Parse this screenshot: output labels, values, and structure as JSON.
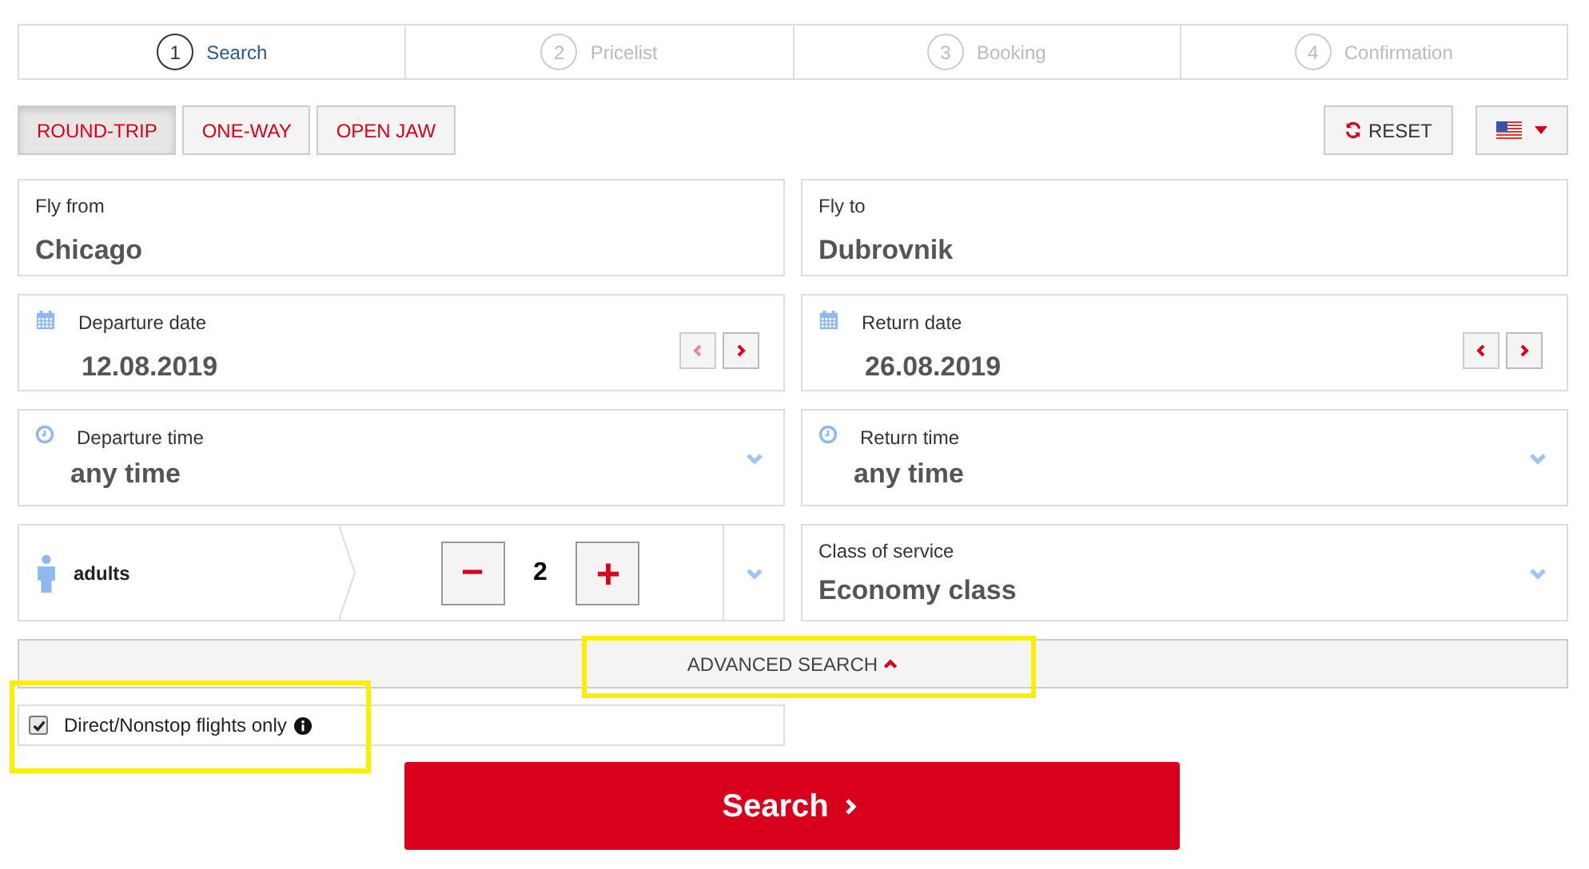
{
  "steps": [
    {
      "number": "1",
      "label": "Search",
      "selected": true
    },
    {
      "number": "2",
      "label": "Pricelist",
      "selected": false
    },
    {
      "number": "3",
      "label": "Booking",
      "selected": false
    },
    {
      "number": "4",
      "label": "Confirmation",
      "selected": false
    }
  ],
  "trip_types": [
    {
      "label": "ROUND-TRIP",
      "selected": true
    },
    {
      "label": "ONE-WAY",
      "selected": false
    },
    {
      "label": "OPEN JAW",
      "selected": false
    }
  ],
  "reset_button": "RESET",
  "fly_from": {
    "label": "Fly from",
    "value": "Chicago"
  },
  "fly_to": {
    "label": "Fly to",
    "value": "Dubrovnik"
  },
  "dates": [
    {
      "label": "Departure date",
      "value": "12.08.2019",
      "prev_disabled": true
    },
    {
      "label": "Return date",
      "value": "26.08.2019",
      "prev_disabled": false
    }
  ],
  "times": [
    {
      "label": "Departure time",
      "value": "any time"
    },
    {
      "label": "Return time",
      "value": "any time"
    }
  ],
  "passengers": {
    "label": "adults",
    "count": "2",
    "minus": "−",
    "plus": "+"
  },
  "class_of_service": {
    "label": "Class of service",
    "value": "Economy class"
  },
  "advanced_search": {
    "label": "ADVANCED SEARCH",
    "expanded": true,
    "highlighted": true
  },
  "direct_only": {
    "label": "Direct/Nonstop flights only",
    "checked": true,
    "highlighted": true
  },
  "search_button": "Search"
}
